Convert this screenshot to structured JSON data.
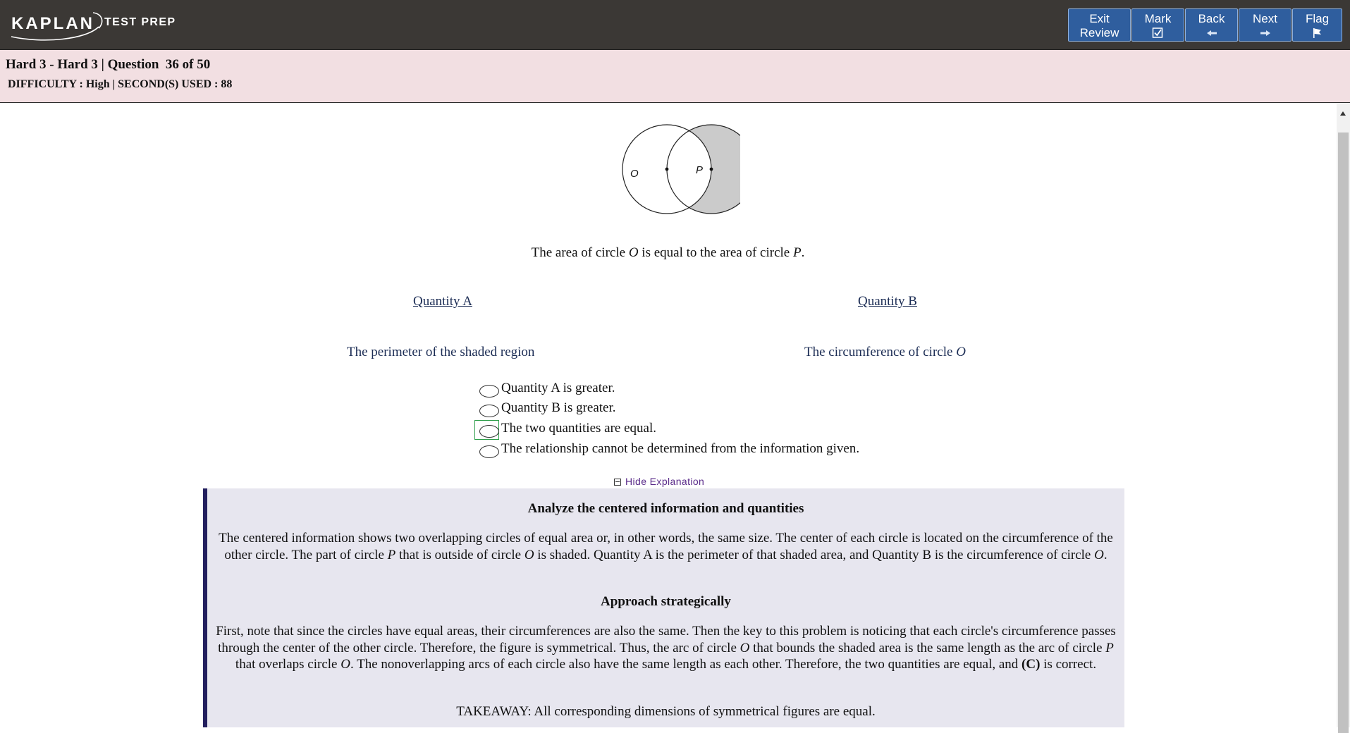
{
  "header": {
    "brand": "KAPLAN",
    "brand_sub": "TEST PREP",
    "buttons": {
      "exit_review": [
        "Exit",
        "Review"
      ],
      "mark": "Mark",
      "back": "Back",
      "next": "Next",
      "flag": "Flag"
    },
    "button_icons": {
      "mark": "checkbox-icon",
      "back": "arrow-left-icon",
      "next": "arrow-right-icon",
      "flag": "flag-icon"
    },
    "colors": {
      "bar": "#3b3835",
      "button": "#2f5e9e",
      "info_bar": "#f2dfe2"
    }
  },
  "info": {
    "title": "Hard 3 - Hard 3 | Question  36 of 50",
    "meta": "DIFFICULTY : High | SECOND(S) USED : 88"
  },
  "question": {
    "figure_labels": {
      "left": "O",
      "right": "P"
    },
    "stem": [
      "The area of circle ",
      "O",
      " is equal to the area of circle ",
      "P",
      "."
    ],
    "quantity_a": {
      "heading": "Quantity A",
      "value": "The perimeter of the shaded region"
    },
    "quantity_b": {
      "heading": "Quantity B",
      "value": "The circumference of circle ",
      "value_var": "O"
    },
    "choices": [
      "Quantity A is greater.",
      "Quantity B is greater.",
      "The two quantities are equal.",
      "The relationship cannot be determined from the information given."
    ],
    "focused_choice_index": 2
  },
  "explanation": {
    "toggle_label": "Hide Explanation",
    "heading1": "Analyze the centered information and quantities",
    "para1": {
      "a": "The centered information shows two overlapping circles of equal area or, in other words, the same size. The center of each circle is located on the circumference of the other circle. The part of circle ",
      "v1": "P",
      "b": " that is outside of circle ",
      "v2": "O",
      "c": " is shaded. Quantity A is the perimeter of that shaded area, and Quantity B is the circumference of circle ",
      "v3": "O",
      "d": "."
    },
    "heading2": "Approach strategically",
    "para2": {
      "a": "First, note that since the circles have equal areas, their circumferences are also the same. Then the key to this problem is noticing that each circle's circumference passes through the center of the other circle. Therefore, the figure is symmetrical. Thus, the arc of circle ",
      "v1": "O",
      "b": " that bounds the shaded area is the same length as the arc of circle ",
      "v2": "P",
      "c": " that overlaps circle ",
      "v3": "O",
      "d": ". The nonoverlapping arcs of each circle also have the same length as each other. Therefore, the two quantities are equal, and ",
      "bold": "(C)",
      "e": " is correct."
    },
    "takeaway": "TAKEAWAY: All corresponding dimensions of symmetrical figures are equal."
  }
}
